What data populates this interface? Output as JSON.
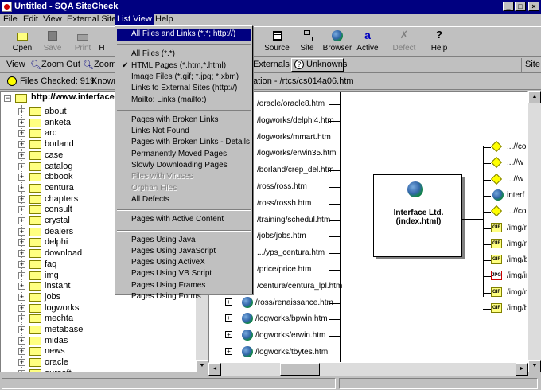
{
  "window": {
    "title": "Untitled - SQA SiteCheck"
  },
  "menubar": [
    "File",
    "Edit",
    "View",
    "External Sites",
    "List View",
    "Help"
  ],
  "toolbar": {
    "left": [
      {
        "label": "Open",
        "icon": "open-folder-icon"
      },
      {
        "label": "Save",
        "icon": "save-icon"
      },
      {
        "label": "Print",
        "icon": "print-icon"
      },
      {
        "label": "H",
        "icon": "help-icon"
      }
    ],
    "right": [
      {
        "label": "Source",
        "icon": "source-icon"
      },
      {
        "label": "Site",
        "icon": "site-icon"
      },
      {
        "label": "Browser",
        "icon": "globe-icon"
      },
      {
        "label": "Active",
        "icon": "active-icon"
      },
      {
        "label": "Defect",
        "icon": "defect-icon"
      },
      {
        "label": "Help",
        "icon": "help-icon"
      }
    ]
  },
  "viewbar": {
    "view": "View",
    "zoom_out": "Zoom Out",
    "zoom_in": "Zoom",
    "externals": "Externals",
    "unknowns": "Unknowns",
    "site": "Site"
  },
  "statusbar": {
    "files_checked": "Files Checked: 919",
    "known": "Known",
    "location": "ation - /rtcs/cs014a06.htm"
  },
  "tree": {
    "root": "http://www.interface.",
    "items": [
      "about",
      "anketa",
      "arc",
      "borland",
      "case",
      "catalog",
      "cbbook",
      "centura",
      "chapters",
      "consult",
      "crystal",
      "dealers",
      "delphi",
      "download",
      "faq",
      "img",
      "instant",
      "jobs",
      "logworks",
      "mechta",
      "metabase",
      "midas",
      "news",
      "oracle",
      "oursoft"
    ]
  },
  "graph": {
    "links": [
      "/oracle/oracle8.htm",
      "/logworks/delphi4.htm",
      "/logworks/mmart.htm",
      "/logworks/erwin35.htm",
      "/borland/crep_del.htm",
      "/ross/ross.htm",
      "/ross/rossh.htm",
      "/training/schedul.htm",
      "/jobs/jobs.htm",
      ".../yps_centura.htm",
      "/price/price.htm",
      "/centura/centura_lpl.htm",
      "/ross/renaissance.htm",
      "/logworks/bpwin.htm",
      "/logworks/erwin.htm",
      "/logworks/tbytes.htm"
    ],
    "center_page": "Interface Ltd. (index.html)",
    "right_nodes": [
      "...//co",
      "...//w",
      "...//w",
      "interf",
      "...//co",
      "/img/r",
      "/img/m",
      "/img/b",
      "/img/ir",
      "/img/m",
      "/img/b"
    ]
  },
  "list_view_menu": {
    "items": [
      {
        "label": "All Files and Links (*.*; http://)",
        "enabled": true,
        "checked": false
      },
      {
        "sep": true
      },
      {
        "label": "All Files (*.*)",
        "enabled": true,
        "checked": false
      },
      {
        "label": "HTML Pages (*.htm,*.html)",
        "enabled": true,
        "checked": true
      },
      {
        "label": "Image Files (*.gif; *.jpg; *.xbm)",
        "enabled": true,
        "checked": false
      },
      {
        "label": "Links to External Sites (http://)",
        "enabled": true,
        "checked": false
      },
      {
        "label": "Mailto: Links (mailto:)",
        "enabled": true,
        "checked": false
      },
      {
        "sep": true
      },
      {
        "label": "Pages with Broken Links",
        "enabled": true,
        "checked": false
      },
      {
        "label": "Links Not Found",
        "enabled": true,
        "checked": false
      },
      {
        "label": "Pages with Broken Links - Details",
        "enabled": true,
        "checked": false
      },
      {
        "label": "Permanently Moved Pages",
        "enabled": true,
        "checked": false
      },
      {
        "label": "Slowly Downloading Pages",
        "enabled": true,
        "checked": false
      },
      {
        "label": "Files with Viruses",
        "enabled": false,
        "checked": false
      },
      {
        "label": "Orphan Files",
        "enabled": false,
        "checked": false
      },
      {
        "label": "All Defects",
        "enabled": true,
        "checked": false
      },
      {
        "sep": true
      },
      {
        "label": "Pages with Active Content",
        "enabled": true,
        "checked": false
      },
      {
        "sep": true
      },
      {
        "label": "Pages Using Java",
        "enabled": true,
        "checked": false
      },
      {
        "label": "Pages Using JavaScript",
        "enabled": true,
        "checked": false
      },
      {
        "label": "Pages Using ActiveX",
        "enabled": true,
        "checked": false
      },
      {
        "label": "Pages Using VB Script",
        "enabled": true,
        "checked": false
      },
      {
        "label": "Pages Using Frames",
        "enabled": true,
        "checked": false
      },
      {
        "label": "Pages Using Forms",
        "enabled": true,
        "checked": false
      }
    ]
  },
  "colors": {
    "titlebar": "#000080",
    "face": "#c0c0c0",
    "folder": "#ffff80"
  }
}
